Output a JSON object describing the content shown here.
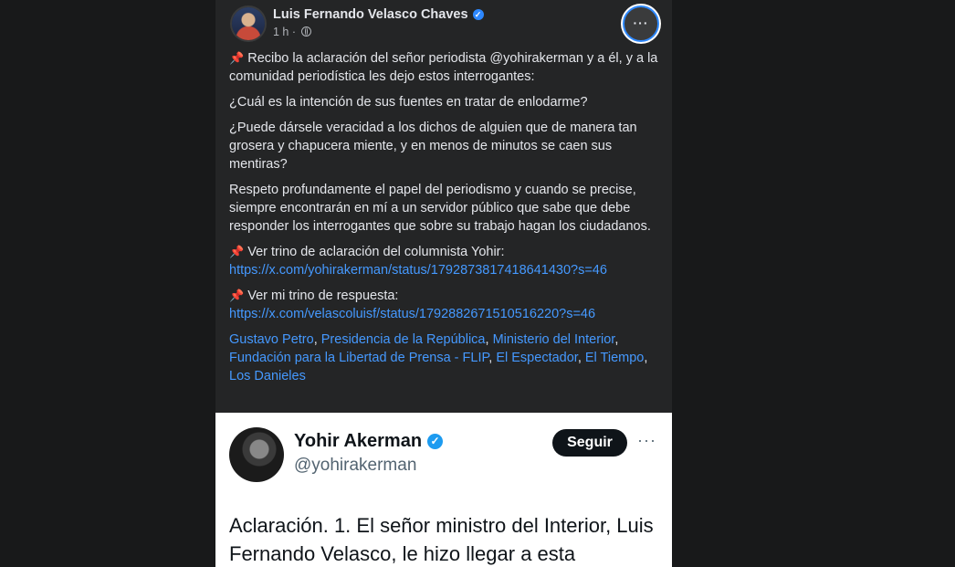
{
  "post": {
    "author": "Luis Fernando Velasco Chaves",
    "time": "1 h ·",
    "more_label": "···",
    "paragraphs": [
      "Recibo la aclaración del señor periodista @yohirakerman y a él, y a la comunidad periodística les dejo estos interrogantes:",
      "¿Cuál es la intención de sus fuentes en tratar de enlodarme?",
      "¿Puede dársele veracidad a los dichos de alguien que de manera tan grosera y chapucera miente, y en menos de minutos se caen sus mentiras?",
      "Respeto profundamente el papel del periodismo y cuando se precise, siempre encontrarán en mí a un servidor público que sabe que debe responder los interrogantes que sobre su trabajo hagan los ciudadanos."
    ],
    "link1_label": "Ver trino de aclaración del columnista Yohir:",
    "link1_url": "https://x.com/yohirakerman/status/1792873817418641430?s=46",
    "link2_label": "Ver mi trino de respuesta:",
    "link2_url": "https://x.com/velascoluisf/status/1792882671510516220?s=46",
    "tags": [
      "Gustavo Petro",
      "Presidencia de la República",
      "Ministerio del Interior",
      "Fundación para la Libertad de Prensa - FLIP",
      "El Espectador",
      "El Tiempo",
      "Los Danieles"
    ],
    "sep": ", ",
    "pin_icon": "pushpin-icon"
  },
  "tweet": {
    "name": "Yohir Akerman",
    "handle": "@yohirakerman",
    "follow_label": "Seguir",
    "more_label": "···",
    "text": "Aclaración. 1. El señor ministro del Interior, Luis Fernando Velasco, le hizo llegar a esta"
  },
  "colors": {
    "link": "#4599ff",
    "verified_fb": "#2d88ff",
    "verified_x": "#1d9bf0"
  }
}
